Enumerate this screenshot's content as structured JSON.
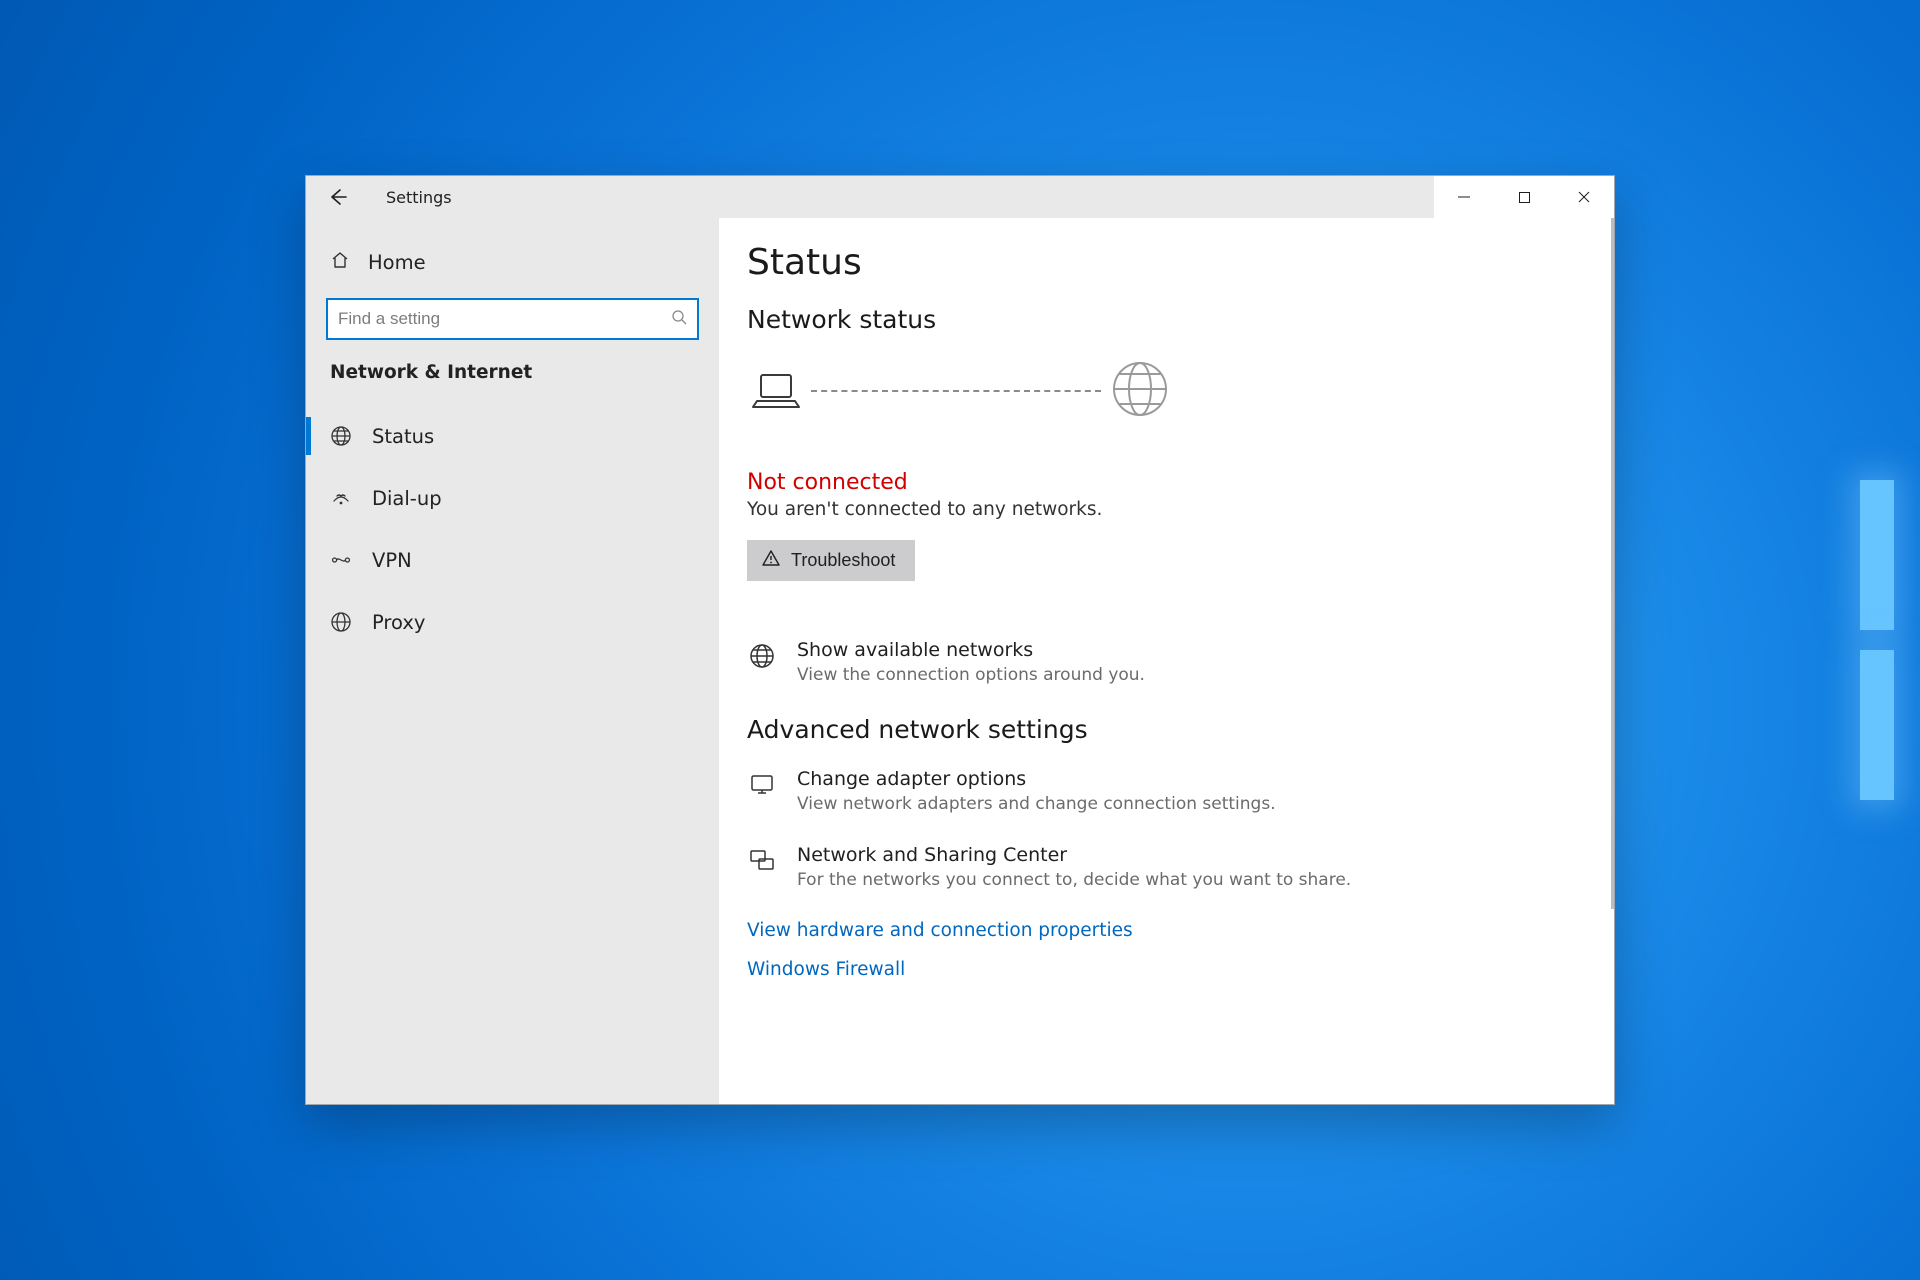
{
  "window": {
    "title": "Settings"
  },
  "sidebar": {
    "home": "Home",
    "search_placeholder": "Find a setting",
    "category": "Network & Internet",
    "items": [
      {
        "label": "Status"
      },
      {
        "label": "Dial-up"
      },
      {
        "label": "VPN"
      },
      {
        "label": "Proxy"
      }
    ]
  },
  "content": {
    "page_title": "Status",
    "section_title": "Network status",
    "conn_status_title": "Not connected",
    "conn_status_sub": "You aren't connected to any networks.",
    "troubleshoot_label": "Troubleshoot",
    "show_networks": {
      "title": "Show available networks",
      "desc": "View the connection options around you."
    },
    "advanced_title": "Advanced network settings",
    "adapter": {
      "title": "Change adapter options",
      "desc": "View network adapters and change connection settings."
    },
    "sharing": {
      "title": "Network and Sharing Center",
      "desc": "For the networks you connect to, decide what you want to share."
    },
    "hw_link": "View hardware and connection properties",
    "firewall_link": "Windows Firewall"
  },
  "colors": {
    "accent": "#0078d4",
    "error": "#d20000",
    "link": "#0067c0"
  }
}
